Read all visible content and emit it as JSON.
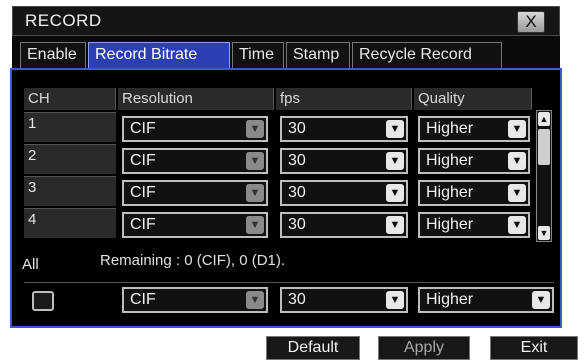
{
  "window": {
    "title": "RECORD",
    "close_label": "X"
  },
  "tabs": [
    {
      "label": "Enable",
      "active": false
    },
    {
      "label": "Record Bitrate",
      "active": true
    },
    {
      "label": "Time",
      "active": false
    },
    {
      "label": "Stamp",
      "active": false
    },
    {
      "label": "Recycle Record",
      "active": false
    }
  ],
  "table": {
    "headers": [
      "CH",
      "Resolution",
      "fps",
      "Quality"
    ],
    "rows": [
      {
        "ch": "1",
        "resolution": "CIF",
        "fps": "30",
        "quality": "Higher"
      },
      {
        "ch": "2",
        "resolution": "CIF",
        "fps": "30",
        "quality": "Higher"
      },
      {
        "ch": "3",
        "resolution": "CIF",
        "fps": "30",
        "quality": "Higher"
      },
      {
        "ch": "4",
        "resolution": "CIF",
        "fps": "30",
        "quality": "Higher"
      }
    ]
  },
  "all": {
    "label": "All",
    "remaining": "Remaining : 0 (CIF), 0 (D1).",
    "resolution": "CIF",
    "fps": "30",
    "quality": "Higher"
  },
  "buttons": {
    "default": "Default",
    "apply": "Apply",
    "exit": "Exit"
  },
  "colors": {
    "accent": "#2b3fb3",
    "panel_border": "#3b58d8"
  }
}
